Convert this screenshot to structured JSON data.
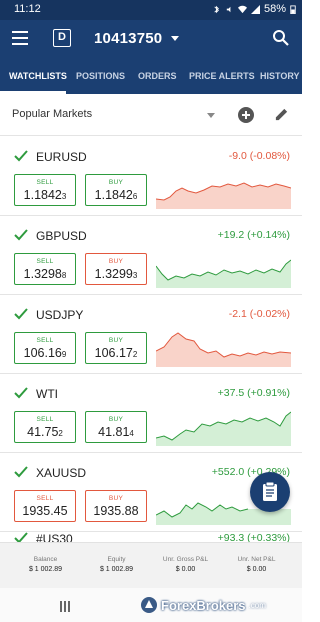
{
  "status_bar": {
    "time": "11:12",
    "battery": "58%",
    "icons": [
      "notification-icon",
      "bluetooth-icon",
      "mute-icon",
      "wifi-icon",
      "signal-icon",
      "battery-icon"
    ]
  },
  "app_bar": {
    "account_badge": "D",
    "account_number": "10413750",
    "menu_icon": "hamburger-icon",
    "search_icon": "search-icon",
    "color": "#1b3f72"
  },
  "tabs": [
    {
      "label": "WATCHLISTS",
      "active": true
    },
    {
      "label": "POSITIONS",
      "active": false
    },
    {
      "label": "ORDERS",
      "active": false
    },
    {
      "label": "PRICE ALERTS",
      "active": false
    },
    {
      "label": "HISTORY",
      "active": false
    }
  ],
  "filter": {
    "label": "Popular Markets"
  },
  "colors": {
    "up": "#2e9b3e",
    "down": "#e2583e"
  },
  "markets": [
    {
      "symbol": "EURUSD",
      "change": "-9.0 (-0.08%)",
      "direction": "down",
      "sell": {
        "label": "SELL",
        "main": "1.1842",
        "small": "3",
        "color": "green"
      },
      "buy": {
        "label": "BUY",
        "main": "1.1842",
        "small": "6",
        "color": "green"
      }
    },
    {
      "symbol": "GBPUSD",
      "change": "+19.2 (+0.14%)",
      "direction": "up",
      "sell": {
        "label": "SELL",
        "main": "1.3298",
        "small": "8",
        "color": "green"
      },
      "buy": {
        "label": "BUY",
        "main": "1.3299",
        "small": "3",
        "color": "red"
      }
    },
    {
      "symbol": "USDJPY",
      "change": "-2.1 (-0.02%)",
      "direction": "down",
      "sell": {
        "label": "SELL",
        "main": "106.16",
        "small": "9",
        "color": "green"
      },
      "buy": {
        "label": "BUY",
        "main": "106.17",
        "small": "2",
        "color": "green"
      }
    },
    {
      "symbol": "WTI",
      "change": "+37.5 (+0.91%)",
      "direction": "up",
      "sell": {
        "label": "SELL",
        "main": "41.75",
        "small": "2",
        "color": "green"
      },
      "buy": {
        "label": "BUY",
        "main": "41.81",
        "small": "4",
        "color": "green"
      }
    },
    {
      "symbol": "XAUUSD",
      "change": "+552.0 (+0.29%)",
      "direction": "up",
      "sell": {
        "label": "SELL",
        "main": "1935.45",
        "small": "",
        "color": "red"
      },
      "buy": {
        "label": "BUY",
        "main": "1935.88",
        "small": "",
        "color": "red"
      }
    },
    {
      "symbol": "#US30",
      "change": "+93.3 (+0.33%)",
      "direction": "up"
    }
  ],
  "summary": [
    {
      "label": "Balance",
      "value": "$ 1 002.89"
    },
    {
      "label": "Equity",
      "value": "$ 1 002.89"
    },
    {
      "label": "Unr. Gross P&L",
      "value": "$ 0.00"
    },
    {
      "label": "Unr. Net P&L",
      "value": "$ 0.00"
    }
  ],
  "watermark": {
    "name": "ForexBrokers",
    "suffix": ".com"
  }
}
